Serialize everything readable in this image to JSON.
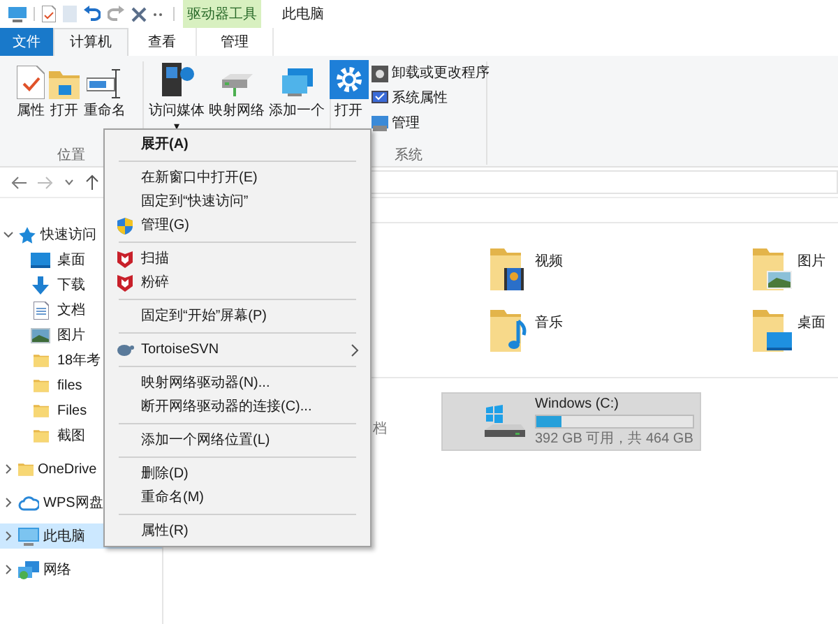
{
  "window": {
    "context_tab_group": "驱动器工具",
    "title": "此电脑"
  },
  "tabs": [
    {
      "label": "文件",
      "kind": "file",
      "selected": false
    },
    {
      "label": "计算机",
      "kind": "tab",
      "selected": true
    },
    {
      "label": "查看",
      "kind": "tab",
      "selected": false
    },
    {
      "label": "管理",
      "kind": "context",
      "selected": false
    }
  ],
  "ribbon": {
    "groups": [
      {
        "label": "位置",
        "buttons": [
          {
            "label": "属性"
          },
          {
            "label": "打开"
          },
          {
            "label": "重命名"
          }
        ]
      },
      {
        "buttons": [
          {
            "label": "访问媒体",
            "caret": "▾"
          },
          {
            "label": "映射网络"
          },
          {
            "label": "添加一个"
          }
        ]
      },
      {
        "label": "系统",
        "buttons": [
          {
            "label": "打开"
          }
        ],
        "small_buttons": [
          "卸载或更改程序",
          "系统属性",
          "管理"
        ]
      }
    ]
  },
  "sidebar": {
    "items": [
      {
        "label": "快速访问",
        "expanded": true,
        "selected": false,
        "children": [
          {
            "label": "桌面",
            "selected": false
          },
          {
            "label": "下载",
            "selected": false
          },
          {
            "label": "文档",
            "selected": false
          },
          {
            "label": "图片",
            "selected": false
          },
          {
            "label": "18年考",
            "selected": false
          },
          {
            "label": "files",
            "selected": false
          },
          {
            "label": "Files",
            "selected": false
          },
          {
            "label": "截图",
            "selected": false
          }
        ]
      },
      {
        "label": "OneDrive",
        "expanded": false,
        "selected": false
      },
      {
        "label": "WPS网盘",
        "expanded": false,
        "selected": false
      },
      {
        "label": "此电脑",
        "expanded": false,
        "selected": true
      },
      {
        "label": "网络",
        "expanded": false,
        "selected": false
      }
    ]
  },
  "folders": [
    {
      "label": "视频"
    },
    {
      "label": "图片"
    },
    {
      "label": "音乐"
    },
    {
      "label": "桌面"
    }
  ],
  "drives": [
    {
      "partial_label": "档"
    }
  ],
  "drive": {
    "name": "Windows (C:)",
    "level": 0.16,
    "space": "392 GB 可用，共 464 GB",
    "selected": true
  },
  "context_menu": {
    "items": [
      {
        "kind": "item",
        "label": "展开(A)",
        "default": true,
        "submenu": false
      },
      {
        "kind": "separator"
      },
      {
        "kind": "item",
        "label": "在新窗口中打开(E)",
        "default": false,
        "submenu": false
      },
      {
        "kind": "item",
        "label": "固定到“快速访问”",
        "default": false,
        "submenu": false
      },
      {
        "kind": "item",
        "label": "管理(G)",
        "default": false,
        "submenu": false
      },
      {
        "kind": "separator"
      },
      {
        "kind": "item",
        "label": "扫描",
        "default": false,
        "submenu": false
      },
      {
        "kind": "item",
        "label": "粉碎",
        "default": false,
        "submenu": false
      },
      {
        "kind": "separator"
      },
      {
        "kind": "item",
        "label": "固定到“开始”屏幕(P)",
        "default": false,
        "submenu": false
      },
      {
        "kind": "separator"
      },
      {
        "kind": "item",
        "label": "TortoiseSVN",
        "default": false,
        "submenu": true
      },
      {
        "kind": "separator"
      },
      {
        "kind": "item",
        "label": "映射网络驱动器(N)...",
        "default": false,
        "submenu": false
      },
      {
        "kind": "item",
        "label": "断开网络驱动器的连接(C)...",
        "default": false,
        "submenu": false
      },
      {
        "kind": "separator"
      },
      {
        "kind": "item",
        "label": "添加一个网络位置(L)",
        "default": false,
        "submenu": false
      },
      {
        "kind": "separator"
      },
      {
        "kind": "item",
        "label": "删除(D)",
        "default": false,
        "submenu": false
      },
      {
        "kind": "item",
        "label": "重命名(M)",
        "default": false,
        "submenu": false
      },
      {
        "kind": "separator"
      },
      {
        "kind": "item",
        "label": "属性(R)",
        "default": false,
        "submenu": false
      }
    ]
  }
}
